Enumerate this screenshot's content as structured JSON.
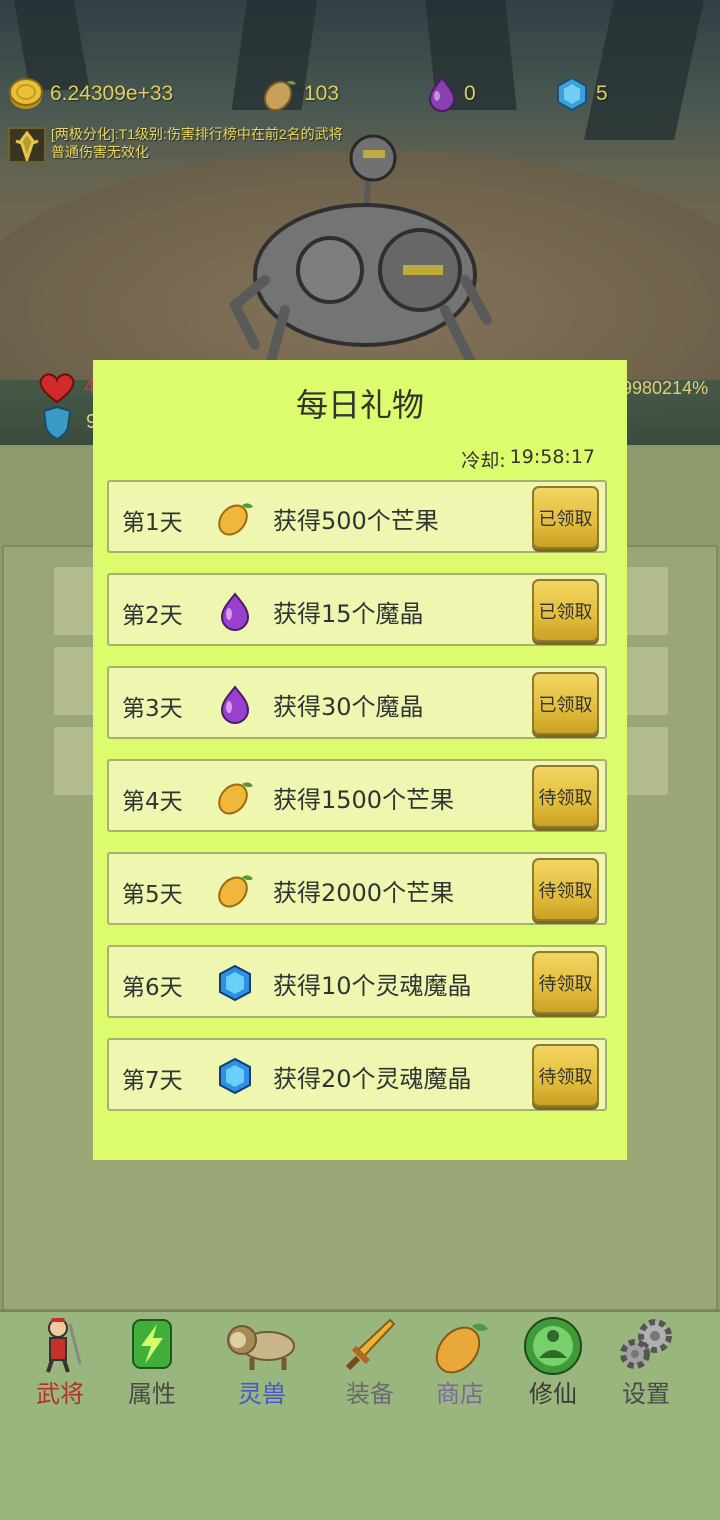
{
  "resources": {
    "gold": "6.24309e+33",
    "mango": "103",
    "magic_crystal": "0",
    "soul_crystal": "5"
  },
  "buff": {
    "line1": "[两极分化]:T1级别:伤害排行榜中在前2名的武将",
    "line2": "普通伤害无效化"
  },
  "boss_hp_fragments": {
    "left_digit": "4",
    "shield_digit": "9",
    "percent": "9980214%"
  },
  "modal": {
    "title": "每日礼物",
    "cooldown_label": "冷却:",
    "cooldown_value": "19:58:17",
    "days": [
      {
        "day": "第1天",
        "icon": "mango-icon",
        "reward": "获得500个芒果",
        "button": "已领取"
      },
      {
        "day": "第2天",
        "icon": "magic-crystal-icon",
        "reward": "获得15个魔晶",
        "button": "已领取"
      },
      {
        "day": "第3天",
        "icon": "magic-crystal-icon",
        "reward": "获得30个魔晶",
        "button": "已领取"
      },
      {
        "day": "第4天",
        "icon": "mango-icon",
        "reward": "获得1500个芒果",
        "button": "待领取"
      },
      {
        "day": "第5天",
        "icon": "mango-icon",
        "reward": "获得2000个芒果",
        "button": "待领取"
      },
      {
        "day": "第6天",
        "icon": "soul-crystal-icon",
        "reward": "获得10个灵魂魔晶",
        "button": "待领取"
      },
      {
        "day": "第7天",
        "icon": "soul-crystal-icon",
        "reward": "获得20个灵魂魔晶",
        "button": "待领取"
      }
    ]
  },
  "nav": [
    {
      "label": "武将",
      "icon": "warrior-icon",
      "color": "#b2332b"
    },
    {
      "label": "属性",
      "icon": "lightning-icon",
      "color": "#4a4a4a"
    },
    {
      "label": "灵兽",
      "icon": "lion-icon",
      "color": "#4a56c8"
    },
    {
      "label": "装备",
      "icon": "sword-icon",
      "color": "#6b6b6b"
    },
    {
      "label": "商店",
      "icon": "mango-icon",
      "color": "#7a6b9a"
    },
    {
      "label": "修仙",
      "icon": "meditation-icon",
      "color": "#3a3a3a"
    },
    {
      "label": "设置",
      "icon": "gear-icon",
      "color": "#4a4a4a"
    }
  ],
  "colors": {
    "modal_bg": "#dcfb6d",
    "row_bg": "#eef6b0",
    "button_gold": "#e2bd3a",
    "nav_bg": "#99b67e",
    "resource_text": "#e2cf5a"
  }
}
